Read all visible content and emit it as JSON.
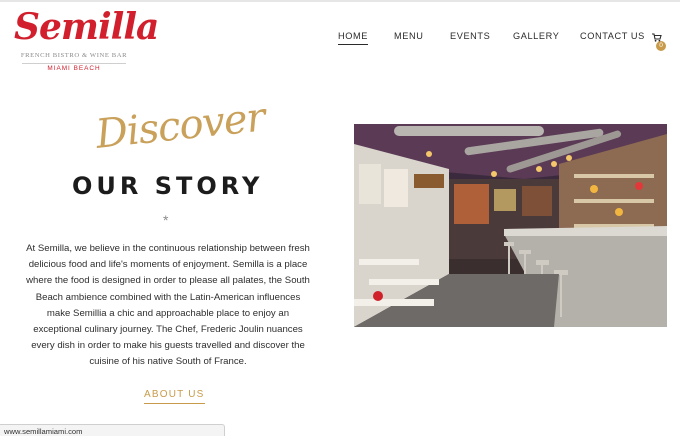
{
  "logo": {
    "word": "Semilla",
    "subtitle": "FRENCH BISTRO & WINE BAR",
    "city": "MIAMI BEACH"
  },
  "nav": {
    "items": [
      {
        "label": "HOME",
        "active": true
      },
      {
        "label": "MENU",
        "active": false
      },
      {
        "label": "EVENTS",
        "active": false
      },
      {
        "label": "GALLERY",
        "active": false
      },
      {
        "label": "CONTACT US",
        "active": false
      }
    ],
    "cart": {
      "icon": "cart-icon",
      "count": "0"
    }
  },
  "hero": {
    "script_word": "Discover",
    "title": "OUR STORY",
    "divider": "*",
    "paragraph_lines": [
      "At Semilla, we believe in the continuous relationship between fresh",
      "delicious food and life's moments of enjoyment. Semilla is a place",
      "where the food is designed in order to please all palates, the South",
      "Beach ambience combined with the Latin-American influences",
      "make Semillia a chic and approachable place to enjoy an",
      "exceptional culinary journey. The Chef, Frederic Joulin nuances",
      "every dish in order to make his guests travelled and discover the",
      "cuisine of his native South of France."
    ],
    "cta": "ABOUT US"
  },
  "status_bar": {
    "url": "www.semillamiami.com"
  },
  "colors": {
    "brand_red": "#d11f2d",
    "gold": "#c89b4a",
    "text": "#2e2e2e"
  }
}
